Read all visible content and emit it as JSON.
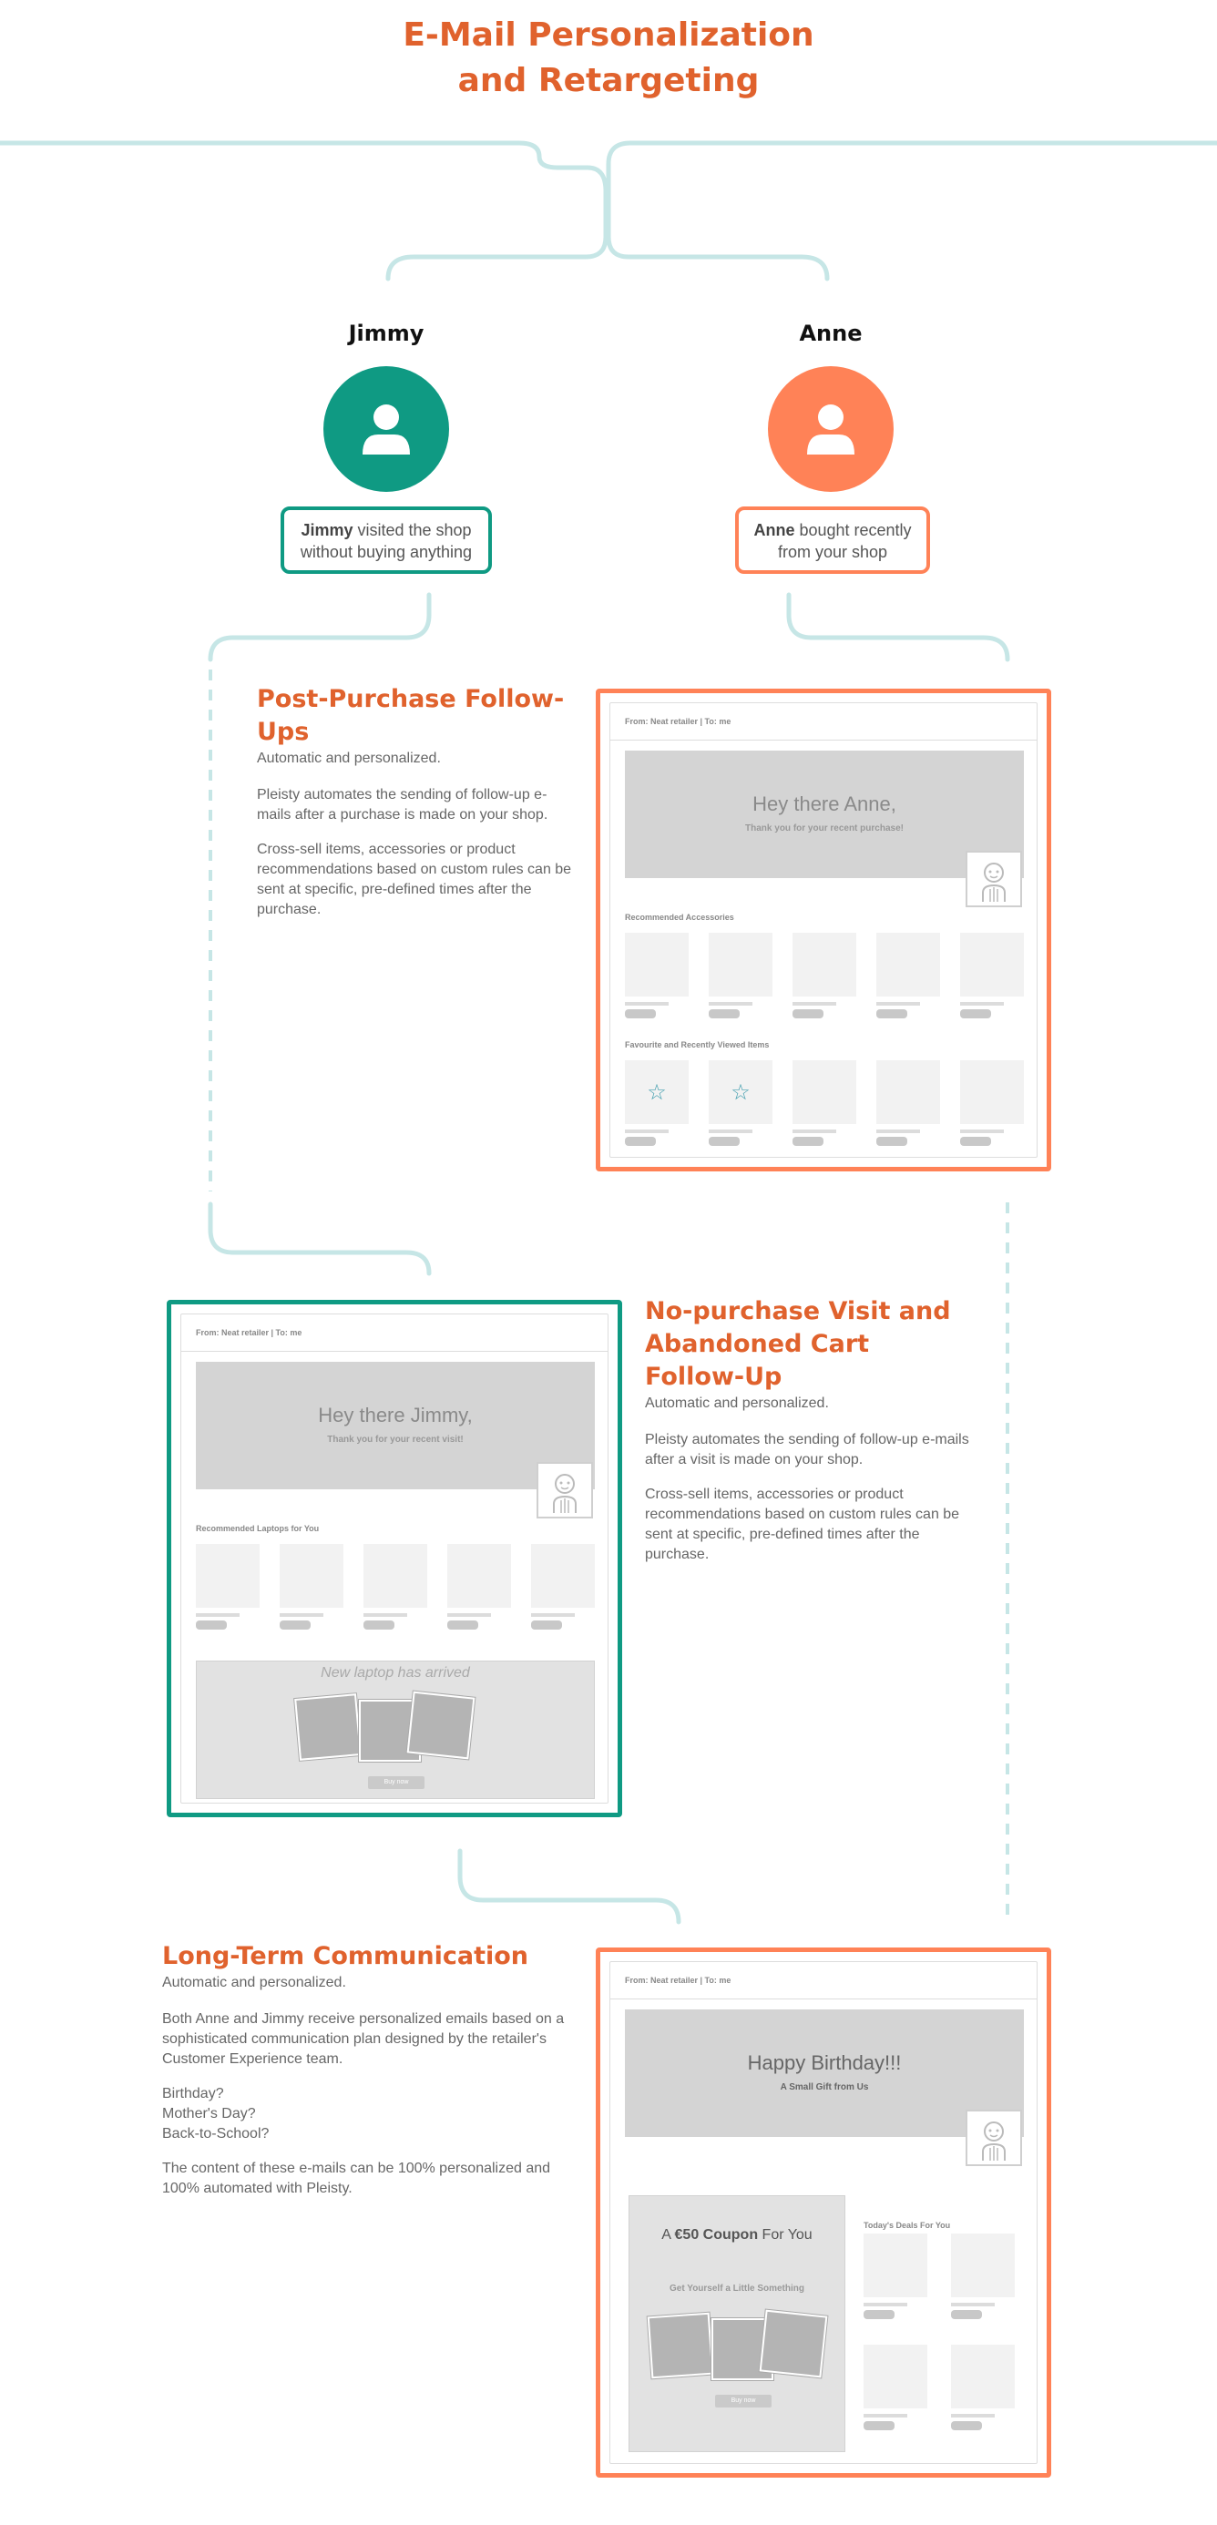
{
  "header": {
    "title_line1": "E-Mail Personalization",
    "title_line2": "and Retargeting"
  },
  "colors": {
    "accent": "#e0622d",
    "jimmy": "#0f9a83",
    "anne": "#ff8257",
    "connector": "#c6e6e6"
  },
  "personas": {
    "jimmy": {
      "name": "Jimmy",
      "bold": "Jimmy",
      "text1": " visited the shop",
      "text2": "without buying anything",
      "icon": "user-icon"
    },
    "anne": {
      "name": "Anne",
      "bold": "Anne",
      "text1": " bought recently",
      "text2": "from your shop",
      "icon": "user-icon"
    }
  },
  "sections": {
    "post_purchase": {
      "title": "Post-Purchase Follow-Ups",
      "subtitle": "Automatic and personalized.",
      "p1": "Pleisty automates the sending of follow-up e-mails after a purchase is made on your shop.",
      "p2": "Cross-sell items, accessories or product recommendations based on custom rules can be sent at specific, pre-defined times after the purchase."
    },
    "no_purchase": {
      "title": "No-purchase Visit and Abandoned Cart Follow-Up",
      "subtitle": "Automatic and personalized.",
      "p1": "Pleisty automates the sending of follow-up e-mails after a visit is made on your shop.",
      "p2": "Cross-sell items, accessories or product recommendations based on custom rules can be sent at specific, pre-defined times after the purchase."
    },
    "long_term": {
      "title": "Long-Term Communication",
      "subtitle": "Automatic and personalized.",
      "p1": "Both Anne and Jimmy receive personalized emails based on a sophisticated communication plan designed by the retailer's Customer Experience team.",
      "l1": "Birthday?",
      "l2": "Mother's Day?",
      "l3": "Back-to-School?",
      "p2": "The content of these e-mails can be 100% personalized and 100% automated with Pleisty."
    }
  },
  "emails": {
    "anne": {
      "from": "From: Neat retailer | To: me",
      "greeting": "Hey there Anne,",
      "sub": "Thank you for your recent purchase!",
      "row1_label": "Recommended Accessories",
      "row2_label": "Favourite and Recently Viewed Items",
      "star_icon": "star-icon"
    },
    "jimmy": {
      "from": "From: Neat retailer | To: me",
      "greeting": "Hey there Jimmy,",
      "sub": "Thank you for your recent visit!",
      "row1_label": "Recommended Laptops for You",
      "banner": "New laptop has arrived",
      "buy": "Buy now"
    },
    "birthday": {
      "from": "From: Neat retailer | To: me",
      "greeting": "Happy Birthday!!!",
      "sub": "A Small Gift from Us",
      "coupon_pre": "A ",
      "coupon_bold": "€50 Coupon",
      "coupon_post": " For You",
      "coupon_sub": "Get Yourself a Little Something",
      "buy": "Buy now",
      "deals_label": "Today's Deals For You"
    }
  }
}
